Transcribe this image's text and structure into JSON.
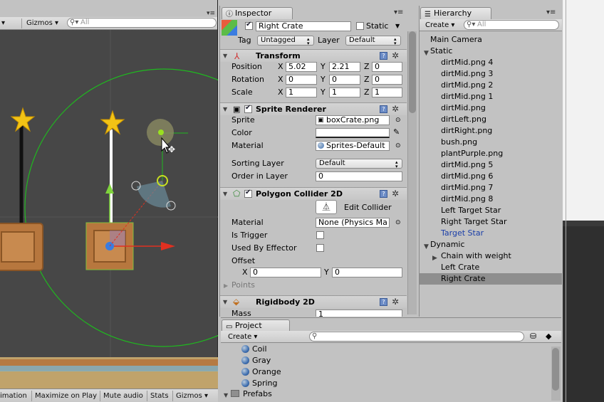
{
  "scene": {
    "gizmos_label": "Gizmos",
    "search_placeholder": "All",
    "bottom_label_left": "imation",
    "bottom_buttons": [
      "Maximize on Play",
      "Mute audio",
      "Stats",
      "Gizmos"
    ]
  },
  "inspector": {
    "tab_label": "Inspector",
    "object_name": "Right Crate",
    "static_label": "Static",
    "tag_label": "Tag",
    "tag_value": "Untagged",
    "layer_label": "Layer",
    "layer_value": "Default",
    "transform": {
      "title": "Transform",
      "position_label": "Position",
      "rotation_label": "Rotation",
      "scale_label": "Scale",
      "position": {
        "x": "5.02",
        "y": "2.21",
        "z": "0"
      },
      "rotation": {
        "x": "0",
        "y": "0",
        "z": "0"
      },
      "scale": {
        "x": "1",
        "y": "1",
        "z": "1"
      },
      "axis_x": "X",
      "axis_y": "Y",
      "axis_z": "Z"
    },
    "sprite_renderer": {
      "title": "Sprite Renderer",
      "sprite_label": "Sprite",
      "sprite_value": "boxCrate.png",
      "color_label": "Color",
      "material_label": "Material",
      "material_value": "Sprites-Default",
      "sorting_layer_label": "Sorting Layer",
      "sorting_layer_value": "Default",
      "order_label": "Order in Layer",
      "order_value": "0"
    },
    "polygon_collider": {
      "title": "Polygon Collider 2D",
      "edit_label": "Edit Collider",
      "material_label": "Material",
      "material_value": "None (Physics Ma",
      "is_trigger_label": "Is Trigger",
      "used_by_effector_label": "Used By Effector",
      "offset_label": "Offset",
      "offset": {
        "x": "0",
        "y": "0"
      },
      "points_label": "Points"
    },
    "rigidbody": {
      "title": "Rigidbody 2D",
      "mass_label": "Mass",
      "mass_value": "1"
    }
  },
  "hierarchy": {
    "tab_label": "Hierarchy",
    "create_label": "Create",
    "search_placeholder": "All",
    "items": [
      {
        "label": "Main Camera",
        "indent": 0
      },
      {
        "label": "Static",
        "indent": 0,
        "expanded": true
      },
      {
        "label": "dirtMid.png 4",
        "indent": 1
      },
      {
        "label": "dirtMid.png 3",
        "indent": 1
      },
      {
        "label": "dirtMid.png 2",
        "indent": 1
      },
      {
        "label": "dirtMid.png 1",
        "indent": 1
      },
      {
        "label": "dirtMid.png",
        "indent": 1
      },
      {
        "label": "dirtLeft.png",
        "indent": 1
      },
      {
        "label": "dirtRight.png",
        "indent": 1
      },
      {
        "label": "bush.png",
        "indent": 1
      },
      {
        "label": "plantPurple.png",
        "indent": 1
      },
      {
        "label": "dirtMid.png 5",
        "indent": 1
      },
      {
        "label": "dirtMid.png 6",
        "indent": 1
      },
      {
        "label": "dirtMid.png 7",
        "indent": 1
      },
      {
        "label": "dirtMid.png 8",
        "indent": 1
      },
      {
        "label": "Left Target Star",
        "indent": 1
      },
      {
        "label": "Right Target Star",
        "indent": 1
      },
      {
        "label": "Target Star",
        "indent": 1,
        "prefab": true
      },
      {
        "label": "Dynamic",
        "indent": 0,
        "expanded": true
      },
      {
        "label": "Chain with weight",
        "indent": 1,
        "collapsed": true
      },
      {
        "label": "Left Crate",
        "indent": 1
      },
      {
        "label": "Right Crate",
        "indent": 1,
        "selected": true
      }
    ]
  },
  "project": {
    "tab_label": "Project",
    "create_label": "Create",
    "items": [
      "Coil",
      "Gray",
      "Orange",
      "Spring"
    ],
    "folder": "Prefabs"
  },
  "colors": {
    "prefab_blue": "#1a3ea8",
    "selection": "#8e8e8e",
    "gizmo_green": "#1fb81f"
  }
}
